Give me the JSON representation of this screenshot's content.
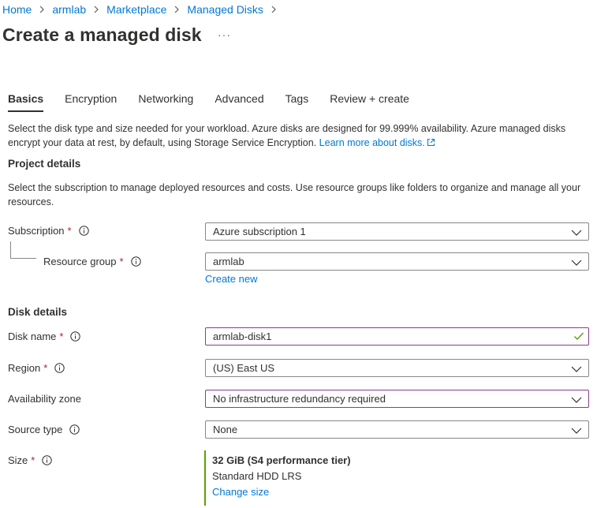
{
  "breadcrumb": [
    {
      "label": "Home"
    },
    {
      "label": "armlab"
    },
    {
      "label": "Marketplace"
    },
    {
      "label": "Managed Disks"
    }
  ],
  "page": {
    "title": "Create a managed disk",
    "more_label": "···"
  },
  "tabs": [
    {
      "label": "Basics",
      "active": true
    },
    {
      "label": "Encryption"
    },
    {
      "label": "Networking"
    },
    {
      "label": "Advanced"
    },
    {
      "label": "Tags"
    },
    {
      "label": "Review + create"
    }
  ],
  "intro": {
    "text": "Select the disk type and size needed for your workload. Azure disks are designed for 99.999% availability. Azure managed disks encrypt your data at rest, by default, using Storage Service Encryption.",
    "learn_more": "Learn more about disks."
  },
  "project": {
    "title": "Project details",
    "description": "Select the subscription to manage deployed resources and costs. Use resource groups like folders to organize and manage all your resources.",
    "subscription_label": "Subscription",
    "subscription_value": "Azure subscription 1",
    "resource_group_label": "Resource group",
    "resource_group_value": "armlab",
    "create_new": "Create new"
  },
  "disk": {
    "title": "Disk details",
    "name_label": "Disk name",
    "name_value": "armlab-disk1",
    "region_label": "Region",
    "region_value": "(US) East US",
    "zone_label": "Availability zone",
    "zone_value": "No infrastructure redundancy required",
    "source_label": "Source type",
    "source_value": "None",
    "size_label": "Size",
    "size_title": "32 GiB (S4 performance tier)",
    "size_sub": "Standard HDD LRS",
    "change_size": "Change size"
  },
  "common": {
    "required_mark": "*"
  },
  "colors": {
    "link": "#0078d4",
    "required": "#a4262c",
    "focus_border": "#8a3b8f",
    "valid_check": "#57a300"
  }
}
